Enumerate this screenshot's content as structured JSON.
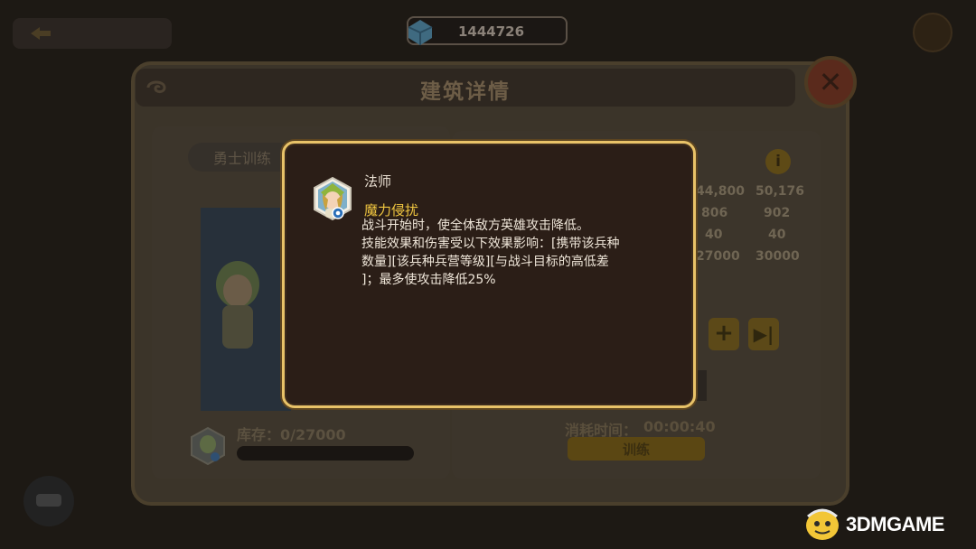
{
  "topbar": {
    "currency_value": "1444726"
  },
  "window": {
    "title": "建筑详情",
    "close_label": "✕"
  },
  "left": {
    "tab_label": "勇士训练",
    "stock_label": "库存：0/27000",
    "stock_progress": 0
  },
  "right": {
    "info_label": "i",
    "stats_col1": [
      "44,800",
      "806",
      "40",
      "27000"
    ],
    "stats_col2": [
      "50,176",
      "902",
      "40",
      "30000"
    ],
    "plus_label": "+",
    "skip_label": "▶|",
    "cost_label": "消耗时间：",
    "cost_value": "00:00:40",
    "train_label": "训练"
  },
  "tooltip": {
    "unit_name": "法师",
    "skill_name": "魔力侵扰",
    "description": "战斗开始时，使全体敌方英雄攻击降低。\n技能效果和伤害受以下效果影响：[携带该兵种\n数量][该兵种兵营等级][与战斗目标的高低差\n]；最多使攻击降低25%"
  },
  "watermark": {
    "text": "3DMGAME"
  },
  "colors": {
    "tooltip_border": "#e8c268",
    "skill_name": "#f0c640",
    "tooltip_bg": "#2b1e17"
  }
}
